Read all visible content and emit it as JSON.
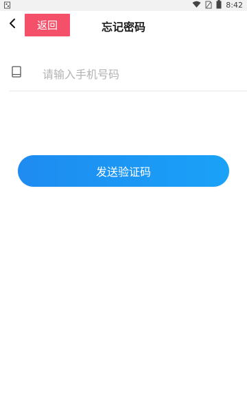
{
  "status_bar": {
    "time": "8:42",
    "icons": [
      "notification-icon",
      "wifi-icon",
      "sim-icon",
      "battery-icon"
    ]
  },
  "header": {
    "back_label": "返回",
    "title": "忘记密码"
  },
  "form": {
    "phone_placeholder": "请输入手机号码",
    "phone_value": ""
  },
  "actions": {
    "send_code_label": "发送验证码"
  },
  "colors": {
    "back_button_bg": "#f4506a",
    "send_button_gradient_start": "#1e8bf1",
    "send_button_gradient_end": "#1aa2f7",
    "divider": "#e6e6e6",
    "placeholder": "#b3b3b3"
  }
}
